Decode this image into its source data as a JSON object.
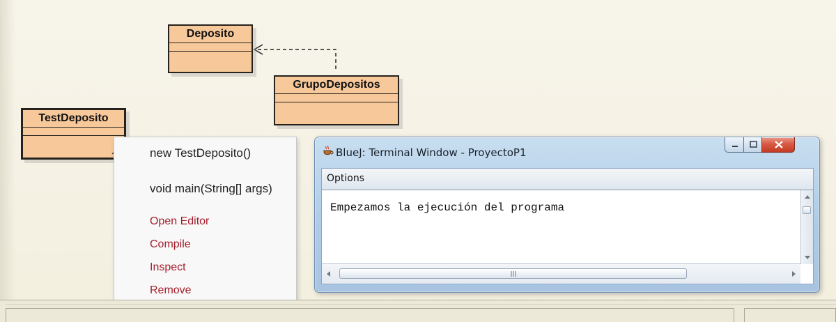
{
  "diagram": {
    "classes": [
      {
        "name": "Deposito"
      },
      {
        "name": "GrupoDepositos"
      },
      {
        "name": "TestDeposito"
      }
    ]
  },
  "context_menu": {
    "items": [
      {
        "label": "new TestDeposito()",
        "style": "normal"
      },
      {
        "label": "void main(String[] args)",
        "style": "normal"
      },
      {
        "label": "Open Editor",
        "style": "red"
      },
      {
        "label": "Compile",
        "style": "red"
      },
      {
        "label": "Inspect",
        "style": "red"
      },
      {
        "label": "Remove",
        "style": "red"
      }
    ]
  },
  "terminal": {
    "title": "BlueJ: Terminal Window - ProyectoP1",
    "menu_label": "Options",
    "output_text": "Empezamos la ejecución del programa"
  },
  "colors": {
    "class_fill": "#f6c89a",
    "menu_red": "#a51f2c",
    "close_red": "#c43b23"
  }
}
